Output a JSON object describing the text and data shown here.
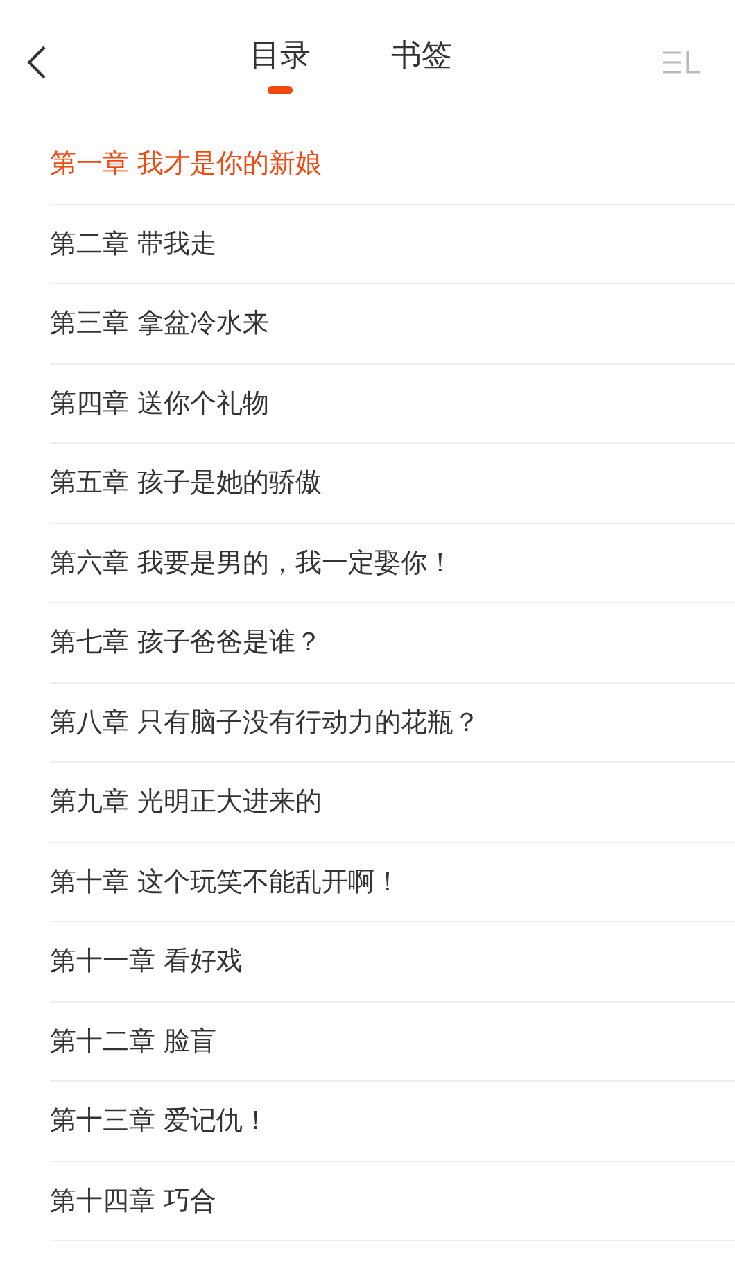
{
  "tabs": [
    {
      "label": "目录",
      "selected": true
    },
    {
      "label": "书签",
      "selected": false
    }
  ],
  "chapters": [
    {
      "title": "第一章 我才是你的新娘",
      "selected": true
    },
    {
      "title": "第二章 带我走",
      "selected": false
    },
    {
      "title": "第三章 拿盆冷水来",
      "selected": false
    },
    {
      "title": "第四章 送你个礼物",
      "selected": false
    },
    {
      "title": "第五章 孩子是她的骄傲",
      "selected": false
    },
    {
      "title": "第六章 我要是男的，我一定娶你！",
      "selected": false
    },
    {
      "title": "第七章 孩子爸爸是谁？",
      "selected": false
    },
    {
      "title": "第八章 只有脑子没有行动力的花瓶？",
      "selected": false
    },
    {
      "title": "第九章 光明正大进来的",
      "selected": false
    },
    {
      "title": "第十章 这个玩笑不能乱开啊！",
      "selected": false
    },
    {
      "title": "第十一章 看好戏",
      "selected": false
    },
    {
      "title": "第十二章 脸盲",
      "selected": false
    },
    {
      "title": "第十三章 爱记仇！",
      "selected": false
    },
    {
      "title": "第十四章 巧合",
      "selected": false
    }
  ]
}
